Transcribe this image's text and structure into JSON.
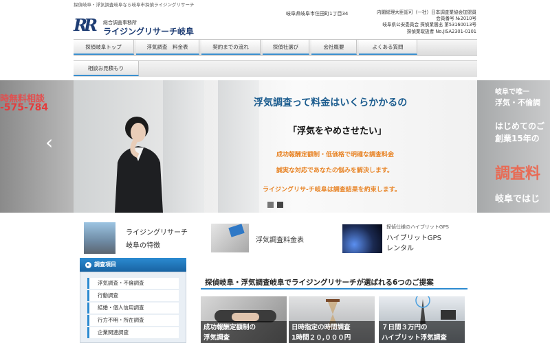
{
  "header": {
    "tagline": "探偵岐阜・浮気調査岐阜なら岐阜市探偵ライジングリサーチ",
    "logo_mark": "RR",
    "logo_sub": "総合調査事務所",
    "logo_name": "ライジングリサーチ岐阜",
    "address": "岐阜県岐阜市住田町1丁目34",
    "license_lines": [
      "内閣総理大臣認可（一社）日本調査業協会加盟員",
      "会員番号 №2010号",
      "岐阜県公安委員会 探偵業届出 第53160013号",
      "探偵業取扱者 No.JISA2301-0101"
    ]
  },
  "nav": {
    "items": [
      "探偵岐阜トップ",
      "浮気調査　料金表",
      "契約までの流れ",
      "探偵社選び",
      "会社概要",
      "よくある質問"
    ],
    "row2": "相談お見積もり"
  },
  "hero": {
    "left_text1": "時無料相談",
    "left_text2": "-575-784",
    "line1": "浮気調査って料金はいくらかかるの",
    "line2": "「浮気をやめさせたい」",
    "line3": "成功報酬定額制・低価格で明確な調査料金",
    "line4": "誠実な対応であなたの悩みを解決します。",
    "line5": "ライジングリサ-チ岐阜は調査結果を約束します。",
    "right_text1": "岐阜で唯一",
    "right_text2": "浮気・不倫調",
    "right_text3": "はじめてのご",
    "right_text4": "創業15年の",
    "right_text5": "調査料",
    "right_text6": "岐阜ではじ"
  },
  "features": {
    "f1": [
      "ライジングリサーチ",
      "岐阜の特徴"
    ],
    "f2": "浮気調査料金表",
    "f3_top": "探偵仕様のハイブリットGPS",
    "f3": [
      "ハイブリットGPS",
      "レンタル"
    ]
  },
  "sidebar": {
    "head": "調査項目",
    "items": [
      "浮気調査・不倫調査",
      "行動調査",
      "結婚・個人信用調査",
      "行方不明・所在調査",
      "企業関連調査"
    ]
  },
  "main": {
    "title": "探偵岐阜・浮気調査岐阜でライジングリサーチが選ばれる6つのご提案",
    "cards": [
      [
        "成功報酬定額制の",
        "浮気調査"
      ],
      [
        "日時指定の時間調査",
        "1時間２０,０００円"
      ],
      [
        "７日間３万円の",
        "ハイブリット浮気調査"
      ]
    ]
  }
}
